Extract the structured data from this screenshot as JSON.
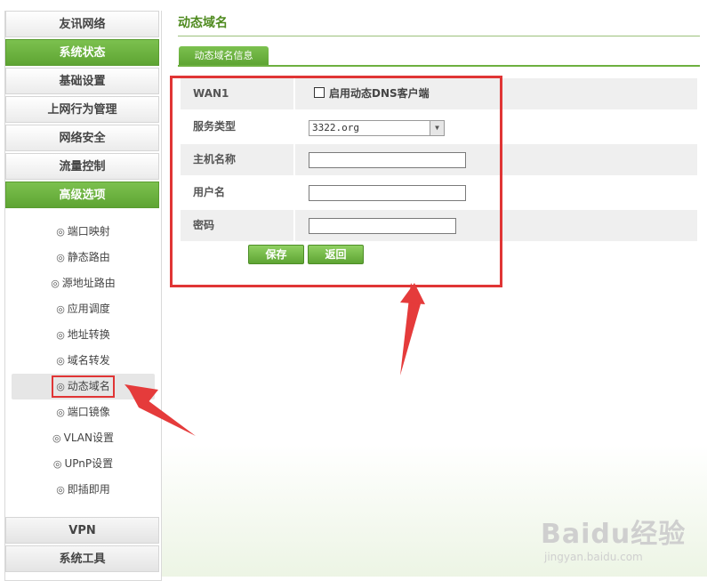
{
  "sidebar": {
    "nav": [
      {
        "label": "友讯网络",
        "active": false
      },
      {
        "label": "系统状态",
        "active": true
      },
      {
        "label": "基础设置",
        "active": false
      },
      {
        "label": "上网行为管理",
        "active": false
      },
      {
        "label": "网络安全",
        "active": false
      },
      {
        "label": "流量控制",
        "active": false
      },
      {
        "label": "高级选项",
        "active": true
      }
    ],
    "submenu": [
      {
        "label": "端口映射"
      },
      {
        "label": "静态路由"
      },
      {
        "label": "源地址路由"
      },
      {
        "label": "应用调度"
      },
      {
        "label": "地址转换"
      },
      {
        "label": "域名转发"
      },
      {
        "label": "动态域名",
        "current": true
      },
      {
        "label": "端口镜像"
      },
      {
        "label": "VLAN设置"
      },
      {
        "label": "UPnP设置"
      },
      {
        "label": "即插即用"
      }
    ],
    "bottom": [
      {
        "label": "VPN"
      },
      {
        "label": "系统工具"
      }
    ],
    "ring_glyph": "◎"
  },
  "main": {
    "title": "动态域名",
    "tab": "动态域名信息",
    "form": {
      "wan_label": "WAN1",
      "enable_label": "启用动态DNS客户端",
      "enable_checked": false,
      "service_label": "服务类型",
      "service_value": "3322.org",
      "host_label": "主机名称",
      "host_value": "",
      "user_label": "用户名",
      "user_value": "",
      "password_label": "密码",
      "password_value": ""
    },
    "save_label": "保存",
    "back_label": "返回"
  },
  "colors": {
    "accent_green": "#6db040",
    "title_green": "#4e8a1e",
    "highlight_red": "#e03535"
  },
  "watermark": {
    "main": "Baidu经验",
    "sub": "jingyan.baidu.com"
  }
}
